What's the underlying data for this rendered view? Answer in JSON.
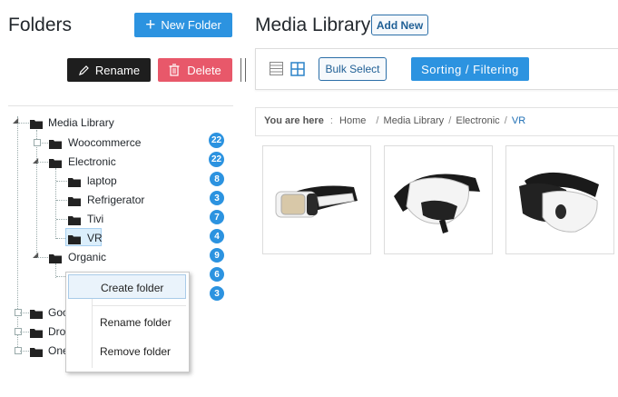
{
  "sidebar": {
    "title": "Folders",
    "new_folder_label": "New Folder",
    "rename_label": "Rename",
    "delete_label": "Delete",
    "tree": {
      "root": "Media Library",
      "woocommerce": {
        "label": "Woocommerce",
        "count": "22"
      },
      "electronic": {
        "label": "Electronic",
        "count": "22"
      },
      "laptop": {
        "label": "laptop",
        "count": "8"
      },
      "refrigerator": {
        "label": "Refrigerator",
        "count": "3"
      },
      "tivi": {
        "label": "Tivi",
        "count": "7"
      },
      "vr": {
        "label": "VR",
        "count": "4"
      },
      "organic": {
        "label": "Organic",
        "count": "9"
      },
      "hidden_child_count": "6",
      "hidden_child2_count": "3",
      "goo": "Goo",
      "dro": "Dro",
      "one": "One"
    },
    "context_menu": {
      "create": "Create folder",
      "rename": "Rename folder",
      "remove": "Remove folder"
    }
  },
  "main": {
    "title": "Media Library",
    "add_new_label": "Add New",
    "bulk_select_label": "Bulk Select",
    "sorting_label": "Sorting / Filtering",
    "breadcrumb": {
      "prefix": "You are here",
      "items": [
        "Home",
        "Media Library",
        "Electronic",
        "VR"
      ]
    },
    "thumbnails": [
      "vr-headset-front",
      "vr-headset-side",
      "vr-headset-angle"
    ]
  },
  "colors": {
    "accent": "#2c93e0",
    "danger": "#e8586a",
    "dark": "#1e1e1e"
  }
}
